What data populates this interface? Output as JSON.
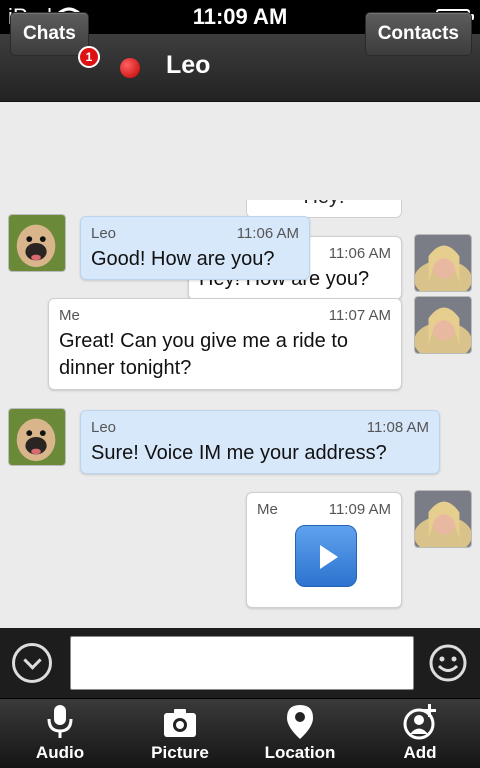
{
  "status_bar": {
    "carrier": "iPod",
    "time": "11:09 AM"
  },
  "header": {
    "chats_label": "Chats",
    "unread_badge": "1",
    "contact_name": "Leo",
    "contacts_label": "Contacts",
    "presence_color": "#d40000"
  },
  "messages": [
    {
      "sender": "Me",
      "time": "11:06 AM",
      "text": "Hey! How are you?"
    },
    {
      "sender": "Leo",
      "time": "11:06 AM",
      "text": "Good! How are you?"
    },
    {
      "sender": "Me",
      "time": "11:07 AM",
      "text": "Great! Can you give me a ride to dinner tonight?"
    },
    {
      "sender": "Leo",
      "time": "11:08 AM",
      "text": "Sure! Voice IM me your address?"
    },
    {
      "sender": "Me",
      "time": "11:09 AM",
      "type": "voice"
    }
  ],
  "partial_message_text": "Hey!",
  "input": {
    "value": "",
    "placeholder": ""
  },
  "tabs": [
    {
      "label": "Audio",
      "icon": "microphone-icon"
    },
    {
      "label": "Picture",
      "icon": "camera-icon"
    },
    {
      "label": "Location",
      "icon": "location-pin-icon"
    },
    {
      "label": "Add",
      "icon": "add-contact-icon"
    }
  ],
  "colors": {
    "incoming_bubble": "#d7e8fb",
    "outgoing_bubble": "#ffffff",
    "play_button": "#3b82dd"
  }
}
